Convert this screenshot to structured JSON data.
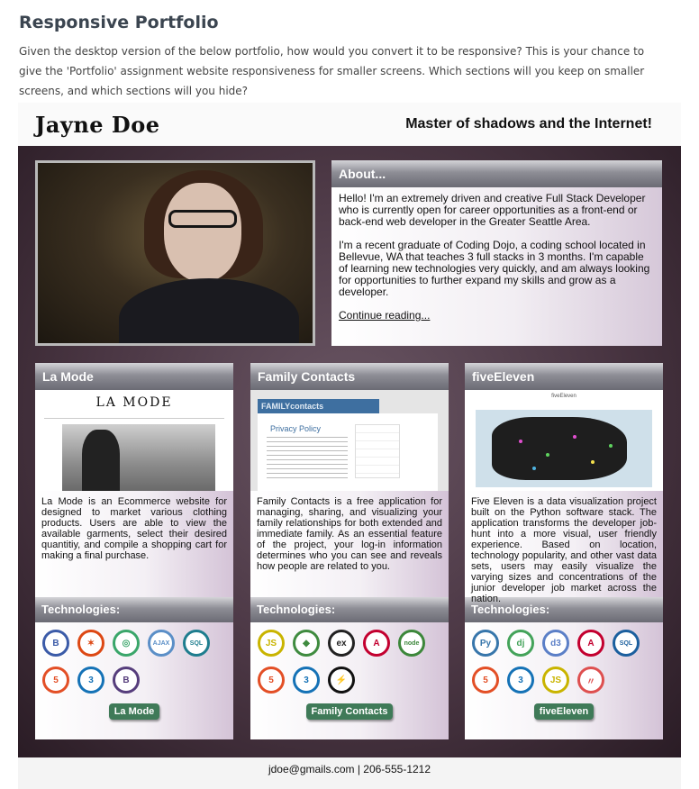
{
  "assignment": {
    "title": "Responsive Portfolio",
    "description": "Given the desktop version of the below portfolio, how would you convert it to be responsive? This is your chance to give the 'Portfolio' assignment website responsiveness for smaller screens. Which sections will you keep on smaller screens, and which sections will you hide?"
  },
  "portfolio": {
    "name": "Jayne Doe",
    "tagline": "Master of shadows and the Internet!",
    "about": {
      "heading": "About...",
      "paragraph1": "Hello! I'm an extremely driven and creative Full Stack Developer who is currently open for career opportunities as a front-end or back-end web developer in the Greater Seattle Area.",
      "paragraph2": "I'm a recent graduate of Coding Dojo, a coding school located in Bellevue, WA that teaches 3 full stacks in 3 months. I'm capable of learning new technologies very quickly, and am always looking for opportunities to further expand my skills and grow as a developer.",
      "link": "Continue reading..."
    },
    "projects": [
      {
        "title": "La Mode",
        "description": "La Mode is an Ecommerce website for designed to market various clothing products. Users are able to view the available garments, select their desired quantitiy, and compile a shopping cart for making a final purchase.",
        "tech_heading": "Technologies:",
        "button": "La Mode",
        "screenshot_logo": "LA MODE",
        "technologies": [
          {
            "icon": "bootstrap-icon",
            "glyph": "B",
            "color": "#3b5ba8"
          },
          {
            "icon": "codeigniter-icon",
            "glyph": "✶",
            "color": "#dd4814"
          },
          {
            "icon": "php-icon",
            "glyph": "◎",
            "color": "#3aa66a"
          },
          {
            "icon": "ajax-icon",
            "glyph": "AJAX",
            "color": "#5b8fc7"
          },
          {
            "icon": "mysql-icon",
            "glyph": "SQL",
            "color": "#1e7d8e"
          },
          {
            "icon": "html5-icon",
            "glyph": "5",
            "color": "#e34f26"
          },
          {
            "icon": "css3-icon",
            "glyph": "3",
            "color": "#1572b6"
          },
          {
            "icon": "bootstrap-b-icon",
            "glyph": "B",
            "color": "#563d7c"
          }
        ]
      },
      {
        "title": "Family Contacts",
        "description": "Family Contacts is a free application for managing, sharing, and visualizing your family relationships for both extended and immediate family. As an essential feature of the project, your log-in information determines who you can see and reveals how people are related to you.",
        "tech_heading": "Technologies:",
        "button": "Family Contacts",
        "screenshot_header": "FAMILYcontacts",
        "screenshot_heading": "Privacy Policy",
        "technologies": [
          {
            "icon": "javascript-icon",
            "glyph": "JS",
            "color": "#c9b400"
          },
          {
            "icon": "mongodb-icon",
            "glyph": "◆",
            "color": "#3f8b3f"
          },
          {
            "icon": "express-icon",
            "glyph": "ex",
            "color": "#222222"
          },
          {
            "icon": "angular-icon",
            "glyph": "A",
            "color": "#c3002f"
          },
          {
            "icon": "nodejs-icon",
            "glyph": "node",
            "color": "#3c873a"
          },
          {
            "icon": "html5-icon",
            "glyph": "5",
            "color": "#e34f26"
          },
          {
            "icon": "css3-icon",
            "glyph": "3",
            "color": "#1572b6"
          },
          {
            "icon": "lightning-icon",
            "glyph": "⚡",
            "color": "#111111"
          }
        ]
      },
      {
        "title": "fiveEleven",
        "description": "Five Eleven is a data visualization project built on the Python software stack. The application transforms the developer job-hunt into a more visual, user friendly experience. Based on location, technology popularity, and other vast data sets, users may easily visualize the varying sizes and concentrations of the junior developer job market across the nation.",
        "tech_heading": "Technologies:",
        "button": "fiveEleven",
        "screenshot_title": "fiveEleven",
        "technologies": [
          {
            "icon": "python-icon",
            "glyph": "Py",
            "color": "#3776ab"
          },
          {
            "icon": "django-icon",
            "glyph": "dj",
            "color": "#44a35a"
          },
          {
            "icon": "d3js-icon",
            "glyph": "d3",
            "color": "#5b7fc7"
          },
          {
            "icon": "angular-icon",
            "glyph": "A",
            "color": "#c3002f"
          },
          {
            "icon": "sqlite-icon",
            "glyph": "SQL",
            "color": "#1b5f9e"
          },
          {
            "icon": "html5-icon",
            "glyph": "5",
            "color": "#e34f26"
          },
          {
            "icon": "css3-icon",
            "glyph": "3",
            "color": "#1572b6"
          },
          {
            "icon": "javascript-icon",
            "glyph": "JS",
            "color": "#c9b400"
          },
          {
            "icon": "meteor-icon",
            "glyph": "〃",
            "color": "#de4f4f"
          }
        ]
      }
    ],
    "footer": {
      "contact": "jdoe@gmails.com | 206-555-1212"
    }
  }
}
